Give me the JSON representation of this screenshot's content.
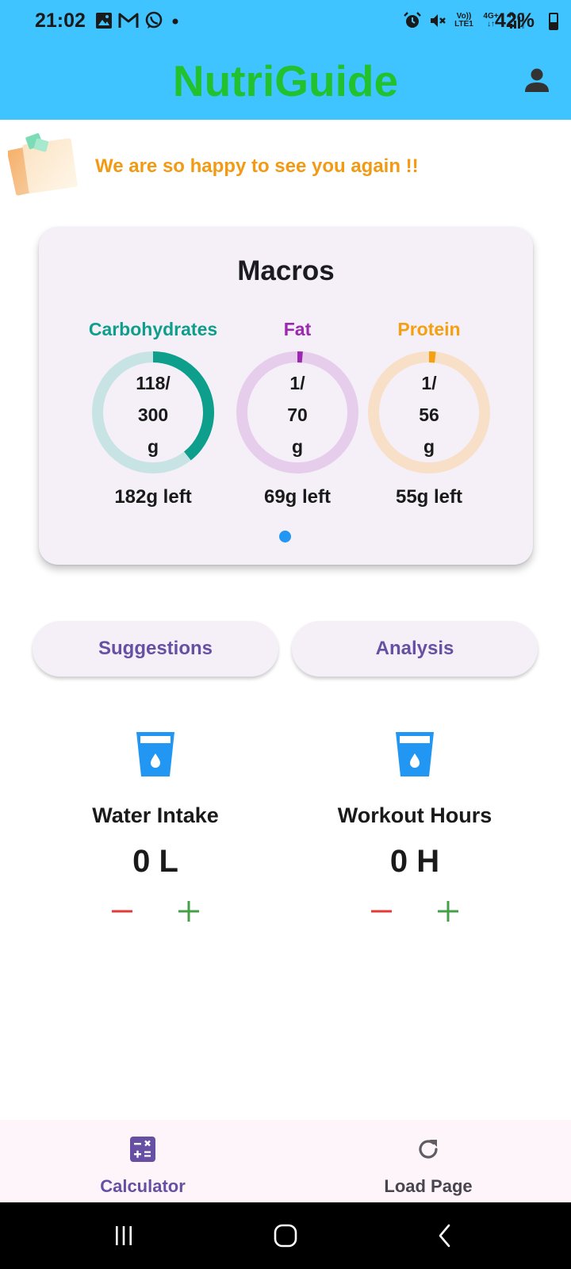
{
  "status_bar": {
    "time": "21:02",
    "left_icons": [
      "image-icon",
      "gmail-icon",
      "whatsapp-icon",
      "dot-icon"
    ],
    "right_icons": [
      "alarm-icon",
      "mute-icon",
      "volte-icon",
      "network-4g-icon",
      "signal-icon"
    ],
    "volte_top": "Vo))",
    "volte_bottom": "LTE1",
    "network_label": "4G+",
    "battery": "42%"
  },
  "app_bar": {
    "title": "NutriGuide",
    "title_color": "#22C12E",
    "background": "#40C4FF",
    "action_icon": "person-icon"
  },
  "welcome": {
    "message": "We are so happy to see you again !!",
    "message_color": "#F29A14",
    "icon": "sticky-notes-icon"
  },
  "macros": {
    "title": "Macros",
    "items": [
      {
        "name": "Carbohydrates",
        "line1": "118/",
        "line2": "300",
        "line3": "g",
        "consumed": 118,
        "target": 300,
        "left_text": "182g left",
        "color": "#0E9E8C",
        "track_color": "#C8E3E4"
      },
      {
        "name": "Fat",
        "line1": "1/",
        "line2": "70",
        "line3": "g",
        "consumed": 1,
        "target": 70,
        "left_text": "69g left",
        "color": "#9C27B0",
        "track_color": "#E6CDEB"
      },
      {
        "name": "Protein",
        "line1": "1/",
        "line2": "56",
        "line3": "g",
        "consumed": 1,
        "target": 56,
        "left_text": "55g left",
        "color": "#F5A010",
        "track_color": "#F8E0C8"
      }
    ],
    "page_indicator_color": "#2196F3"
  },
  "actions": {
    "suggestions": "Suggestions",
    "analysis": "Analysis"
  },
  "trackers": {
    "water": {
      "label": "Water Intake",
      "value": "0 L",
      "icon": "water-glass-icon"
    },
    "workout": {
      "label": "Workout Hours",
      "value": "0 H",
      "icon": "water-glass-icon"
    },
    "minus_color": "#E53935",
    "plus_color": "#43A047",
    "icon_color": "#2196F3"
  },
  "bottom_nav": {
    "items": [
      {
        "label": "Calculator",
        "icon": "calculator-icon",
        "active": true,
        "color": "#6750A4"
      },
      {
        "label": "Load Page",
        "icon": "refresh-icon",
        "active": false,
        "color": "#49454F"
      }
    ]
  },
  "system_nav": {
    "icons": [
      "recent-apps-icon",
      "home-icon",
      "back-icon"
    ]
  }
}
